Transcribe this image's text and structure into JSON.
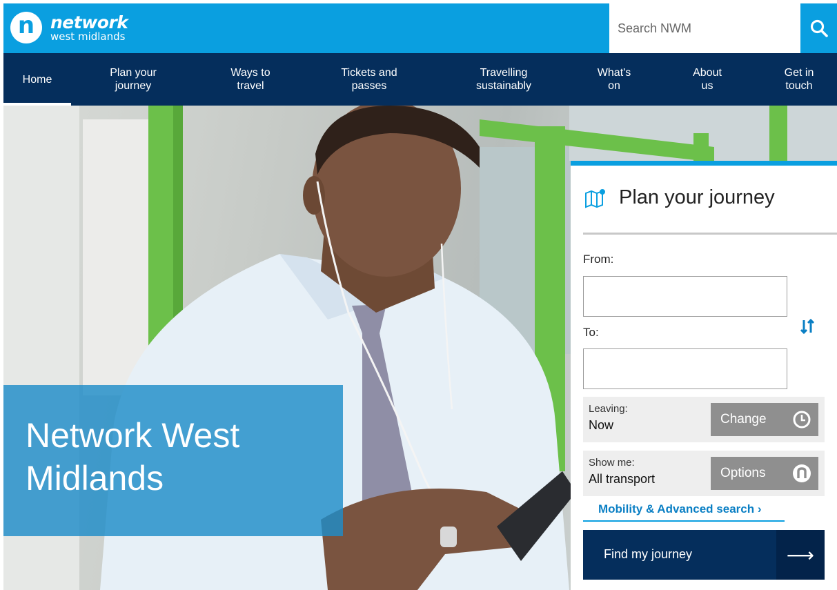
{
  "header": {
    "logo_letter": "n",
    "logo_line1": "network",
    "logo_line2": "west midlands",
    "search_placeholder": "Search NWM",
    "brand_color": "#0a9fe0",
    "nav_color": "#052e5c"
  },
  "nav": {
    "items": [
      {
        "label": "Home",
        "active": true
      },
      {
        "label": "Plan your\njourney",
        "active": false
      },
      {
        "label": "Ways to\ntravel",
        "active": false
      },
      {
        "label": "Tickets and\npasses",
        "active": false
      },
      {
        "label": "Travelling\nsustainably",
        "active": false
      },
      {
        "label": "What's\non",
        "active": false
      },
      {
        "label": "About\nus",
        "active": false
      },
      {
        "label": "Get in\ntouch",
        "active": false
      }
    ]
  },
  "hero": {
    "title": "Network West Midlands"
  },
  "journey_planner": {
    "title": "Plan your journey",
    "from_label": "From:",
    "from_value": "",
    "to_label": "To:",
    "to_value": "",
    "leaving_label": "Leaving:",
    "leaving_value": "Now",
    "change_label": "Change",
    "show_me_label": "Show me:",
    "show_me_value": "All transport",
    "options_label": "Options",
    "advanced_link": "Mobility & Advanced search ›",
    "find_button": "Find my journey",
    "find_arrow": "⟶"
  }
}
